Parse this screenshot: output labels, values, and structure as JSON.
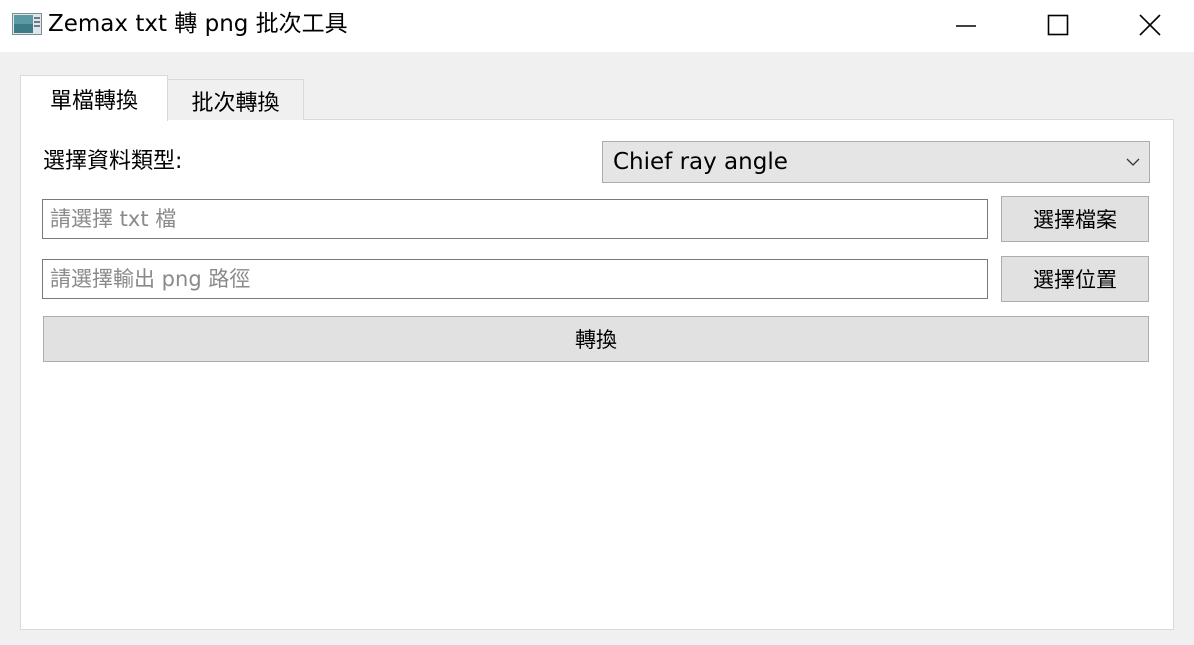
{
  "window": {
    "title": "Zemax txt 轉 png 批次工具",
    "icon": "app-window-icon",
    "controls": [
      "minimize-icon",
      "maximize-icon",
      "close-icon"
    ]
  },
  "tabs": [
    {
      "label": "單檔轉換",
      "active": true
    },
    {
      "label": "批次轉換",
      "active": false
    }
  ],
  "form": {
    "type_label": "選擇資料類型:",
    "type_selected": "Chief ray angle",
    "txt_placeholder": "請選擇 txt 檔",
    "png_placeholder": "請選擇輸出 png 路徑",
    "pick_file_label": "選擇檔案",
    "pick_location_label": "選擇位置",
    "convert_label": "轉換"
  },
  "colors": {
    "titlebar": "#ffffff",
    "window_bg": "#f0f0f0",
    "button_bg": "#e1e1e1",
    "border": "#adadad",
    "placeholder": "#8a8a8a"
  }
}
